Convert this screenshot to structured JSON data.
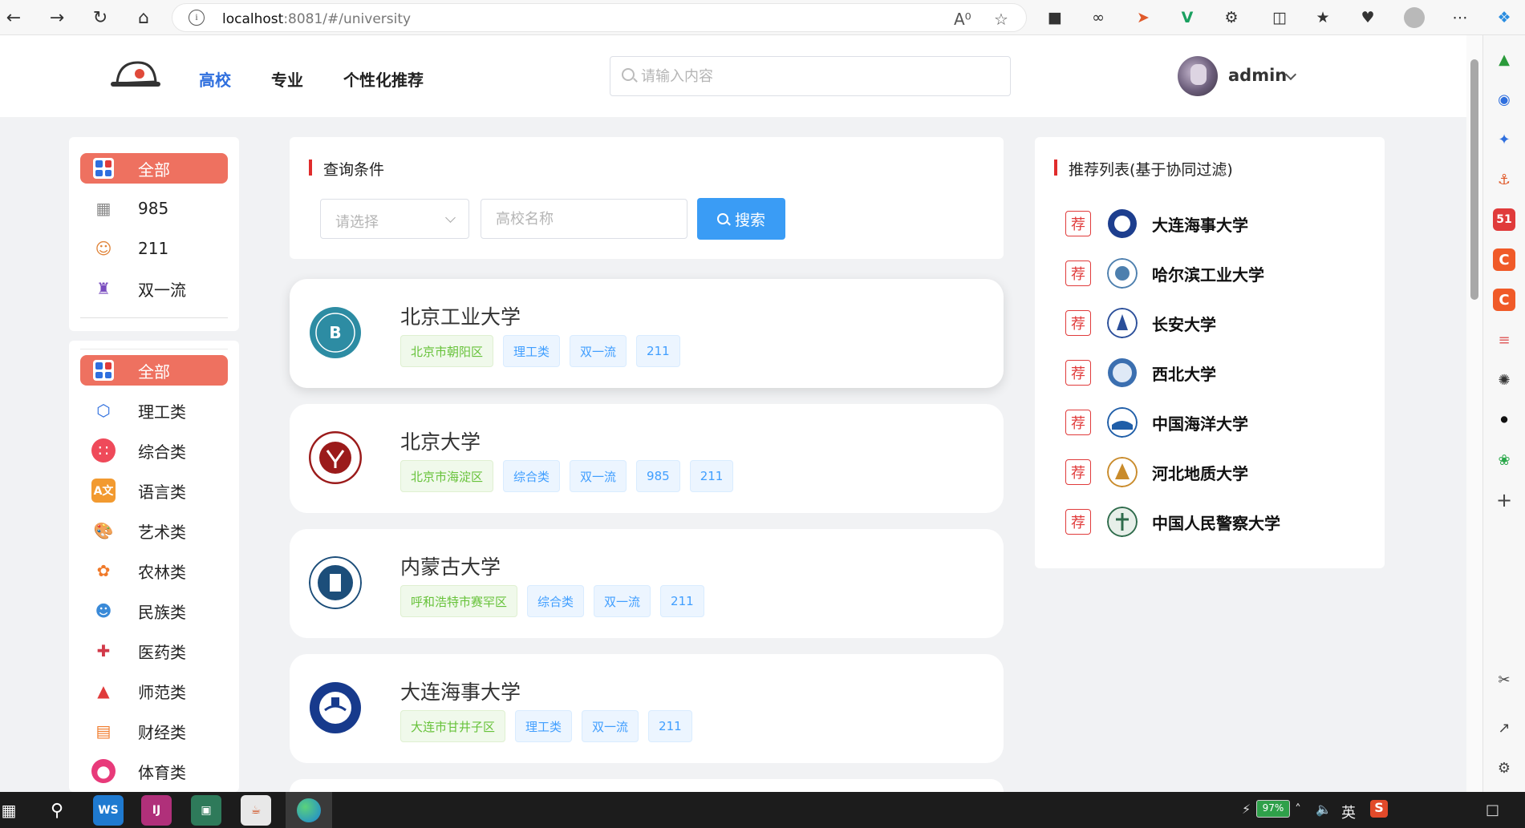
{
  "browser": {
    "url_host": "localhost",
    "url_rest": ":8081/#/university"
  },
  "header": {
    "nav": [
      "高校",
      "专业",
      "个性化推荐"
    ],
    "active_nav": 0,
    "search_placeholder": "请输入内容",
    "user": "admin"
  },
  "levels": [
    {
      "label": "全部",
      "icon": "grid-icon",
      "active": true
    },
    {
      "label": "985",
      "icon": "building-icon"
    },
    {
      "label": "211",
      "icon": "student-icon"
    },
    {
      "label": "双一流",
      "icon": "castle-icon"
    }
  ],
  "categories": [
    {
      "label": "全部",
      "icon": "grid-icon",
      "active": true
    },
    {
      "label": "理工类",
      "icon": "cube-icon"
    },
    {
      "label": "综合类",
      "icon": "apps-icon"
    },
    {
      "label": "语言类",
      "icon": "translate-icon"
    },
    {
      "label": "艺术类",
      "icon": "palette-icon"
    },
    {
      "label": "农林类",
      "icon": "plant-icon"
    },
    {
      "label": "民族类",
      "icon": "people-icon"
    },
    {
      "label": "医药类",
      "icon": "medicine-icon"
    },
    {
      "label": "师范类",
      "icon": "graduation-cap-icon"
    },
    {
      "label": "财经类",
      "icon": "bar-chart-icon"
    },
    {
      "label": "体育类",
      "icon": "basketball-icon"
    }
  ],
  "query": {
    "title": "查询条件",
    "select_placeholder": "请选择",
    "name_placeholder": "高校名称",
    "search_button": "搜索"
  },
  "universities": [
    {
      "name": "北京工业大学",
      "tags": [
        "北京市朝阳区",
        "理工类",
        "双一流",
        "211"
      ],
      "color": "#2d8ca3"
    },
    {
      "name": "北京大学",
      "tags": [
        "北京市海淀区",
        "综合类",
        "双一流",
        "985",
        "211"
      ],
      "color": "#9b1b1b"
    },
    {
      "name": "内蒙古大学",
      "tags": [
        "呼和浩特市赛罕区",
        "综合类",
        "双一流",
        "211"
      ],
      "color": "#1c4e7a"
    },
    {
      "name": "大连海事大学",
      "tags": [
        "大连市甘井子区",
        "理工类",
        "双一流",
        "211"
      ],
      "color": "#173a8c"
    }
  ],
  "recommend": {
    "title": "推荐列表(基于协同过滤)",
    "badge": "荐",
    "items": [
      {
        "name": "大连海事大学",
        "color": "#1d3e8e"
      },
      {
        "name": "哈尔滨工业大学",
        "color": "#4d7fae"
      },
      {
        "name": "长安大学",
        "color": "#2b4f9a"
      },
      {
        "name": "西北大学",
        "color": "#3b6fb0"
      },
      {
        "name": "中国海洋大学",
        "color": "#1f5ea8"
      },
      {
        "name": "河北地质大学",
        "color": "#c98b2b"
      },
      {
        "name": "中国人民警察大学",
        "color": "#2e6b4b"
      }
    ]
  },
  "taskbar": {
    "battery": "97%",
    "ime": "英"
  },
  "colors": {
    "accent": "#2f6fde",
    "active_bg": "#ee7160",
    "search_btn": "#3a9cf5",
    "badge": "#e03b3b"
  }
}
